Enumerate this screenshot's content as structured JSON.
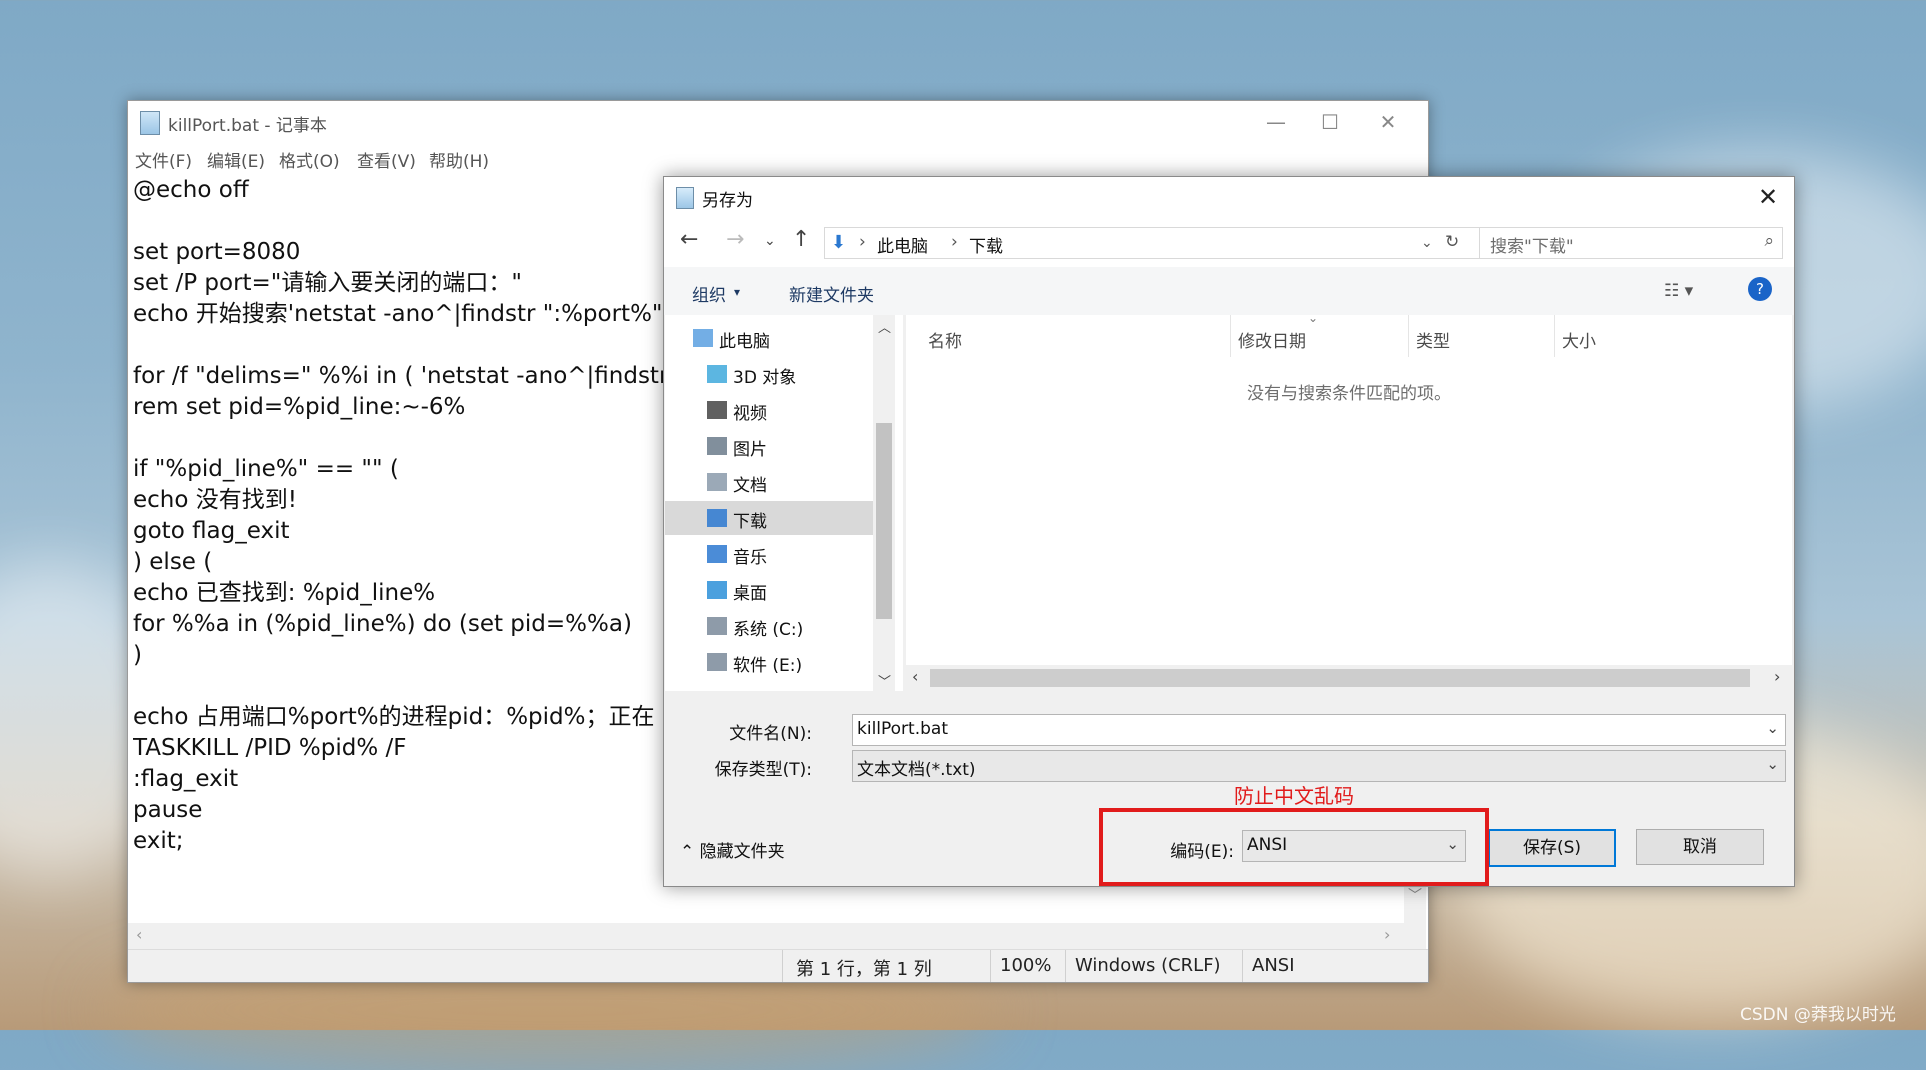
{
  "notepad": {
    "title": "killPort.bat - 记事本",
    "menu": [
      "文件(F)",
      "编辑(E)",
      "格式(O)",
      "查看(V)",
      "帮助(H)"
    ],
    "lines": [
      "@echo off",
      "",
      "set port=8080",
      "set /P port=\"请输入要关闭的端口：\"",
      "echo 开始搜索'netstat -ano^|findstr \":%port%\"",
      "",
      "for /f \"delims=\" %%i in ( 'netstat -ano^|findstr",
      "rem set pid=%pid_line:~-6%",
      "",
      "if \"%pid_line%\" == \"\" (",
      "echo 没有找到!",
      "goto flag_exit",
      ") else (",
      "echo 已查找到: %pid_line%",
      "for %%a in (%pid_line%) do (set pid=%%a)",
      ")",
      "",
      "echo 占用端口%port%的进程pid：%pid%；正在",
      "TASKKILL /PID %pid% /F",
      ":flag_exit",
      "pause",
      "exit;"
    ],
    "status": {
      "position": "第 1 行，第 1 列",
      "zoom": "100%",
      "line_ending": "Windows (CRLF)",
      "encoding": "ANSI"
    }
  },
  "dialog": {
    "title": "另存为",
    "breadcrumb": [
      "此电脑",
      "下载"
    ],
    "search_placeholder": "搜索\"下载\"",
    "toolbar": {
      "organize": "组织",
      "new_folder": "新建文件夹"
    },
    "nav_items": [
      "此电脑",
      "3D 对象",
      "视频",
      "图片",
      "文档",
      "下载",
      "音乐",
      "桌面",
      "系统 (C:)",
      "软件 (E:)"
    ],
    "selected_nav": "下载",
    "columns": [
      "名称",
      "修改日期",
      "类型",
      "大小"
    ],
    "empty_message": "没有与搜索条件匹配的项。",
    "filename_label": "文件名(N):",
    "filename_value": "killPort.bat",
    "filetype_label": "保存类型(T):",
    "filetype_value": "文本文档(*.txt)",
    "hide_folders": "隐藏文件夹",
    "encoding_label": "编码(E):",
    "encoding_value": "ANSI",
    "save_button": "保存(S)",
    "cancel_button": "取消"
  },
  "annotation": "防止中文乱码",
  "watermark": "CSDN @莽我以时光",
  "colors": {
    "annotation_red": "#e11b1b",
    "accent_blue": "#0078d7"
  }
}
